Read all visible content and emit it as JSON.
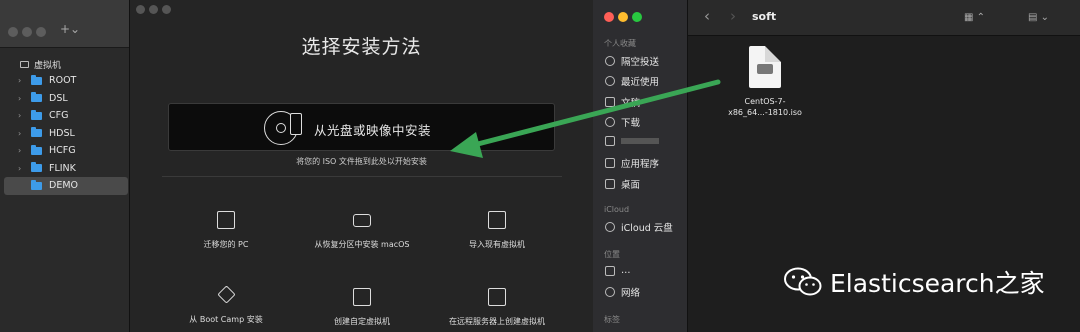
{
  "library": {
    "section_title": "虚拟机",
    "items": [
      {
        "label": "ROOT"
      },
      {
        "label": "DSL"
      },
      {
        "label": "CFG"
      },
      {
        "label": "HDSL"
      },
      {
        "label": "HCFG"
      },
      {
        "label": "FLINK"
      },
      {
        "label": "DEMO",
        "selected": true
      }
    ]
  },
  "install": {
    "title": "选择安装方法",
    "drop_label": "从光盘或映像中安装",
    "drop_hint": "将您的 ISO 文件拖到此处以开始安装",
    "options": [
      {
        "label": "迁移您的 PC",
        "icon": "migrate-pc-icon"
      },
      {
        "label": "从恢复分区中安装 macOS",
        "icon": "recovery-drive-icon"
      },
      {
        "label": "导入现有虚拟机",
        "icon": "import-vm-icon"
      },
      {
        "label": "从 Boot Camp 安装",
        "icon": "bootcamp-icon"
      },
      {
        "label": "创建自定虚拟机",
        "icon": "custom-vm-icon"
      },
      {
        "label": "在远程服务器上创建虚拟机",
        "icon": "remote-vm-icon"
      }
    ]
  },
  "finder": {
    "sidebar": {
      "favorites_title": "个人收藏",
      "favorites": [
        {
          "label": "隔空投送",
          "icon": "airdrop-icon"
        },
        {
          "label": "最近使用",
          "icon": "recents-icon"
        },
        {
          "label": "文稿",
          "icon": "documents-icon"
        },
        {
          "label": "下载",
          "icon": "downloads-icon"
        },
        {
          "label": "",
          "icon": "home-icon"
        },
        {
          "label": "应用程序",
          "icon": "applications-icon"
        },
        {
          "label": "桌面",
          "icon": "desktop-icon"
        }
      ],
      "icloud_title": "iCloud",
      "icloud_items": [
        {
          "label": "iCloud 云盘",
          "icon": "icloud-drive-icon"
        }
      ],
      "locations_title": "位置",
      "locations": [
        {
          "label": "…",
          "icon": "disk-icon"
        },
        {
          "label": "网络",
          "icon": "network-icon"
        }
      ],
      "tags_title": "标签"
    },
    "folder_title": "soft",
    "file": {
      "name": "CentOS-7-x86_64...-1810.iso"
    }
  },
  "watermark": {
    "text": "Elasticsearch之家"
  },
  "colors": {
    "folder": "#3d9be9",
    "arrow": "#3aa655",
    "red": "#ff5f57",
    "yellow": "#febc2e",
    "green": "#28c840"
  }
}
